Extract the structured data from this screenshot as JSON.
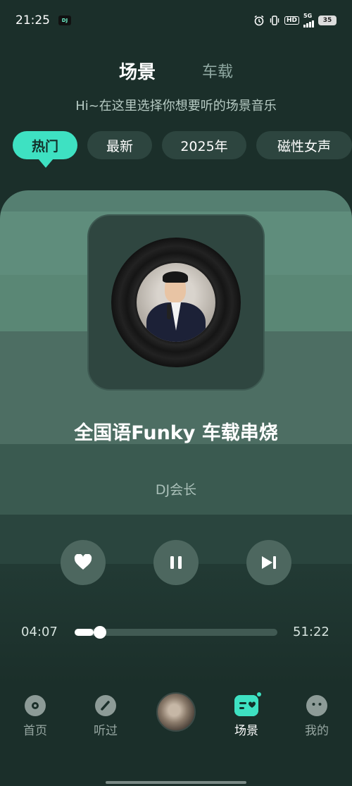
{
  "status_bar": {
    "time": "21:25",
    "app_badge": "DJ",
    "network": "5G",
    "hd": "HD",
    "battery": "35"
  },
  "top_tabs": [
    {
      "label": "场景",
      "active": true
    },
    {
      "label": "车载",
      "active": false
    }
  ],
  "subtitle": "Hi~在这里选择你想要听的场景音乐",
  "chips": [
    {
      "label": "热门",
      "active": true
    },
    {
      "label": "最新",
      "active": false
    },
    {
      "label": "2025年",
      "active": false
    },
    {
      "label": "磁性女声",
      "active": false
    }
  ],
  "player": {
    "title": "全国语Funky 车载串烧",
    "artist": "DJ会长",
    "elapsed": "04:07",
    "duration": "51:22",
    "progress": 0.08,
    "controls": [
      "favorite",
      "pause",
      "next"
    ]
  },
  "bottom_nav": [
    {
      "label": "首页",
      "icon": "disc-icon",
      "active": false
    },
    {
      "label": "听过",
      "icon": "history-icon",
      "active": false
    },
    {
      "label": "",
      "icon": "now-playing-avatar",
      "active": false
    },
    {
      "label": "场景",
      "icon": "scene-icon",
      "active": true
    },
    {
      "label": "我的",
      "icon": "profile-icon",
      "active": false
    }
  ],
  "colors": {
    "accent": "#3ee1c2",
    "background": "#1b2f2a",
    "card": "#557f71"
  }
}
